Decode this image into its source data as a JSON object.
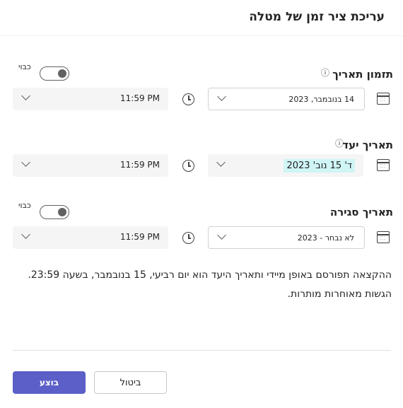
{
  "dialog": {
    "title": "עריכת ציר זמן של מטלה"
  },
  "schedule": {
    "label": "תזמון תאריך",
    "toggle_label": "כבוי",
    "date_value": "14 בנובמבר, 2023",
    "time_value": "11:59 PM"
  },
  "due": {
    "label": "תאריך יעד",
    "date_value": "ד' 15 נוב' 2023",
    "time_value": "11:59 PM"
  },
  "close": {
    "label": "תאריך סגירה",
    "toggle_label": "כבוי",
    "date_value": "לא נבחר - 2023",
    "time_value": "11:59 PM"
  },
  "note": {
    "line1": "ההקצאה תפורסם באופן מיידי ותאריך היעד הוא יום רביעי, 15 בנובמבר, בשעה 23:59.",
    "line2": "הגשות מאוחרות מותרות."
  },
  "footer": {
    "done_label": "בוצע",
    "cancel_label": "ביטול"
  },
  "colors": {
    "primary": "#5b5fc7",
    "highlight": "#d0f5f5"
  }
}
